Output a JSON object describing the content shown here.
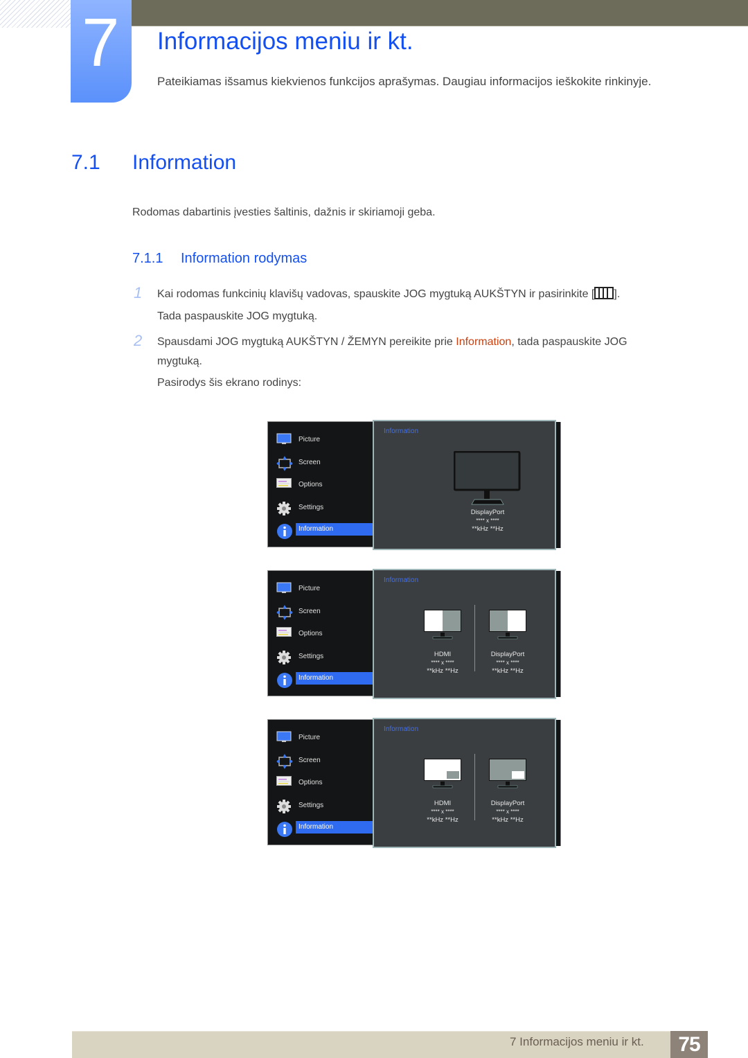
{
  "chapter": {
    "number": "7",
    "title": "Informacijos meniu ir kt.",
    "intro": "Pateikiamas išsamus kiekvienos funkcijos aprašymas. Daugiau informacijos ieškokite rinkinyje."
  },
  "section": {
    "number": "7.1",
    "title": "Information",
    "description": "Rodomas dabartinis įvesties šaltinis, dažnis ir skiriamoji geba."
  },
  "subsection": {
    "number": "7.1.1",
    "title": "Information rodymas"
  },
  "steps": [
    {
      "number": "1",
      "text_before_icon": "Kai rodomas funkcinių klavišų vadovas, spauskite JOG mygtuką AUKŠTYN ir pasirinkite [",
      "icon": "menu-key-icon",
      "text_after_icon": "].",
      "line2": "Tada paspauskite JOG mygtuką."
    },
    {
      "number": "2",
      "text_before_highlight": "Spausdami JOG mygtuką AUKŠTYN / ŽEMYN pereikite prie ",
      "highlight": "Information",
      "text_after_highlight": ", tada paspauskite JOG",
      "line2": "mygtuką.",
      "line3": "Pasirodys šis ekrano rodinys:"
    }
  ],
  "osd_menu": {
    "items": [
      {
        "label": "Picture",
        "icon": "picture-icon"
      },
      {
        "label": "Screen",
        "icon": "screen-icon"
      },
      {
        "label": "Options",
        "icon": "options-icon"
      },
      {
        "label": "Settings",
        "icon": "settings-gear-icon"
      },
      {
        "label": "Information",
        "icon": "information-icon",
        "active": true
      }
    ],
    "panel_title": "Information",
    "accent_color": "#2e6bf0"
  },
  "screens": [
    {
      "layout": "single",
      "sources": [
        {
          "name": "DisplayPort",
          "resolution": "**** x ****",
          "frequency": "**kHz **Hz"
        }
      ]
    },
    {
      "layout": "pbp",
      "sources": [
        {
          "name": "HDMI",
          "resolution": "**** x ****",
          "frequency": "**kHz **Hz"
        },
        {
          "name": "DisplayPort",
          "resolution": "**** x ****",
          "frequency": "**kHz **Hz"
        }
      ]
    },
    {
      "layout": "pip",
      "sources": [
        {
          "name": "HDMI",
          "resolution": "**** x ****",
          "frequency": "**kHz **Hz"
        },
        {
          "name": "DisplayPort",
          "resolution": "**** x ****",
          "frequency": "**kHz **Hz"
        }
      ]
    }
  ],
  "footer": {
    "chapter_label": "7 Informacijos meniu ir kt.",
    "page_number": "75"
  }
}
